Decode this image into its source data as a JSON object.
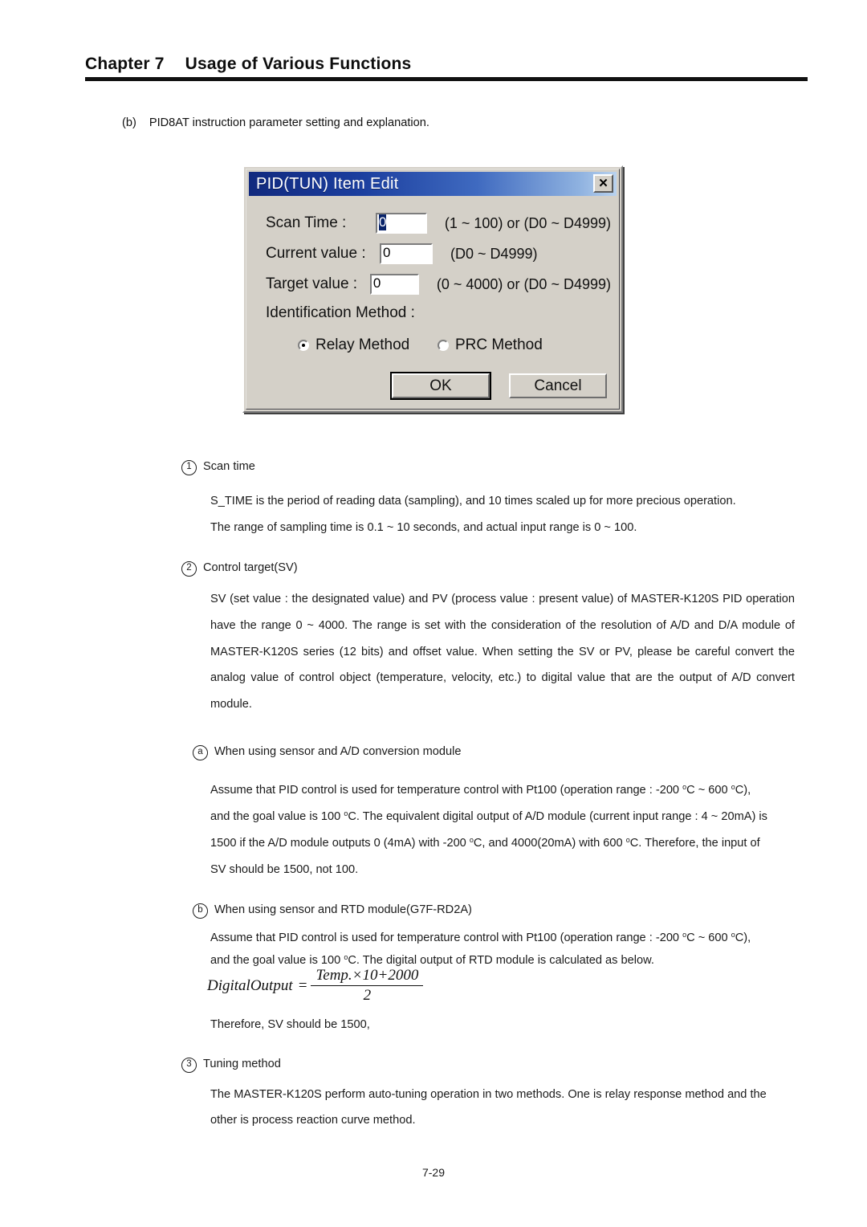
{
  "header": {
    "chapter": "Chapter 7",
    "title": "Usage of Various Functions"
  },
  "lead": {
    "marker": "(b)",
    "text": "PID8AT instruction parameter setting and explanation."
  },
  "dialog": {
    "title": "PID(TUN) Item Edit",
    "close_icon": "✕",
    "fields": [
      {
        "label": "Scan Time :",
        "value": "0",
        "hint": "(1 ~ 100) or (D0 ~ D4999)",
        "selected": true
      },
      {
        "label": "Current value :",
        "value": "0",
        "hint": "(D0 ~ D4999)",
        "selected": false
      },
      {
        "label": "Target value :",
        "value": "0",
        "hint": "(0 ~ 4000) or (D0 ~ D4999)",
        "selected": false
      }
    ],
    "identification_label": "Identification Method :",
    "radios": [
      {
        "label": "Relay Method",
        "checked": true
      },
      {
        "label": "PRC Method",
        "checked": false
      }
    ],
    "ok_label": "OK",
    "cancel_label": "Cancel"
  },
  "sections": {
    "s1": {
      "marker": "1",
      "heading": "Scan time",
      "p1": "S_TIME is the period of reading data (sampling), and 10 times scaled up for more precious operation.",
      "p2": "The range of sampling time is 0.1 ~ 10 seconds, and actual input range is 0 ~ 100."
    },
    "s2": {
      "marker": "2",
      "heading": "Control target(SV)",
      "body": "SV (set value : the designated value) and PV (process value : present value) of MASTER-K120S PID operation have the range 0 ~ 4000. The range is set with the consideration of the resolution of A/D and D/A module of MASTER-K120S series (12 bits) and offset value. When setting the SV or PV, please be careful convert the analog value of control object (temperature, velocity, etc.) to digital value that are the output of A/D convert module.",
      "sub_a": {
        "marker": "a",
        "heading": "When using sensor and A/D conversion module",
        "line1_pre": "Assume that PID control is used for temperature control with Pt100 (operation range : -200 ",
        "line1_mid": "C ~ 600 ",
        "line1_post": "C),",
        "line2_pre": "and the goal value is 100 ",
        "line2_post": "C. The equivalent digital output of A/D module (current input range : 4 ~ 20mA) is",
        "line3_pre": "1500 if the A/D module outputs 0 (4mA) with -200 ",
        "line3_mid": "C, and 4000(20mA) with 600 ",
        "line3_post": "C. Therefore, the input of",
        "line4": "SV should be 1500, not 100."
      },
      "sub_b": {
        "marker": "b",
        "heading": "When using sensor and RTD module(G7F-RD2A)",
        "line1_pre": "Assume that PID control is used for temperature control with Pt100 (operation range : -200 ",
        "line1_mid": "C ~ 600 ",
        "line1_post": "C),",
        "line2_pre": "and the goal value is 100 ",
        "line2_post": "C. The digital output of RTD module is calculated as below.",
        "formula": {
          "lhs": "DigitalOutput",
          "equals": "=",
          "numerator": "Temp.×10+2000",
          "denominator": "2"
        },
        "line3": "Therefore, SV should be 1500,"
      }
    },
    "s3": {
      "marker": "3",
      "heading": "Tuning method",
      "p1": "The MASTER-K120S perform auto-tuning operation in two methods. One is relay response method and the",
      "p2": "other is process reaction curve method."
    }
  },
  "degree_symbol": "o",
  "footer": {
    "page_number": "7-29"
  }
}
